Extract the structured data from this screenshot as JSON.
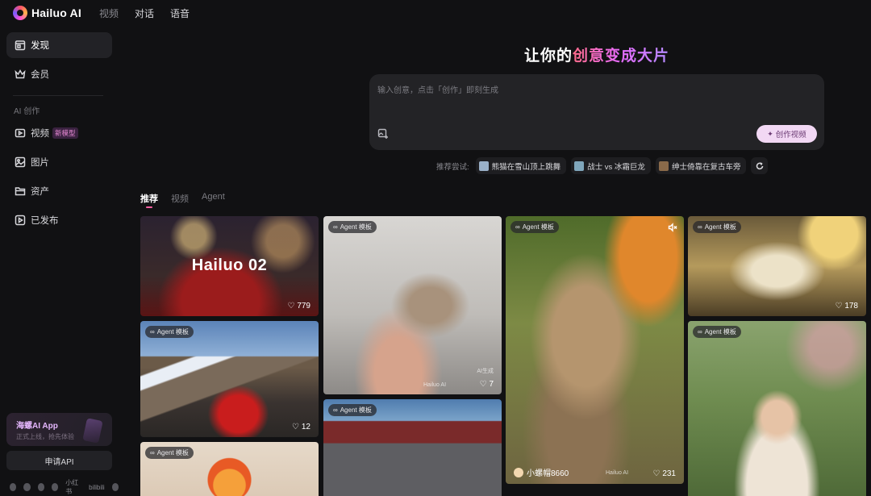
{
  "brand": {
    "name": "Hailuo AI"
  },
  "topnav": [
    {
      "label": "视频",
      "dim": true
    },
    {
      "label": "对话",
      "dim": false
    },
    {
      "label": "语音",
      "dim": false
    }
  ],
  "sidebar": {
    "items": [
      {
        "label": "发现",
        "icon": "calendar-icon"
      },
      {
        "label": "会员",
        "icon": "crown-icon"
      }
    ],
    "section_title": "AI 创作",
    "create_items": [
      {
        "label": "视频",
        "icon": "video-icon",
        "badge": "新模型"
      },
      {
        "label": "图片",
        "icon": "image-icon"
      },
      {
        "label": "资产",
        "icon": "folder-icon"
      },
      {
        "label": "已发布",
        "icon": "publish-icon"
      }
    ],
    "app_card": {
      "title": "海螺AI App",
      "subtitle": "正式上线，抢先体验"
    },
    "api_button": "申请API",
    "social": {
      "t1": "小红书",
      "t2": "bilibili"
    }
  },
  "hero": {
    "title_plain": "让你的",
    "title_grad": "创意变成大片",
    "prompt_placeholder": "输入创意，点击「创作」即刻生成",
    "create_button": "创作视频"
  },
  "suggestions": {
    "label": "推荐尝试:",
    "chips": [
      {
        "text": "熊猫在雪山顶上跳舞",
        "color": "#9ab0c8"
      },
      {
        "text": "战士 vs 冰霜巨龙",
        "color": "#7fa6bb"
      },
      {
        "text": "绅士倚靠在复古车旁",
        "color": "#8a6a4a"
      }
    ]
  },
  "tabs": [
    {
      "label": "推荐",
      "active": true
    },
    {
      "label": "视频",
      "active": false
    },
    {
      "label": "Agent",
      "active": false
    }
  ],
  "gallery": {
    "agent_badge": "Agent 模板",
    "watermark_ai": "AI生成",
    "watermark_brand": "Hailuo AI",
    "cards": {
      "hailuo02": {
        "title": "Hailuo 02",
        "likes": "779"
      },
      "mountain": {
        "likes": "12"
      },
      "kitten": {
        "likes": "7"
      },
      "cat_tiger": {
        "author": "小螺帽8660",
        "likes": "231"
      },
      "deer": {
        "likes": "178"
      }
    }
  }
}
